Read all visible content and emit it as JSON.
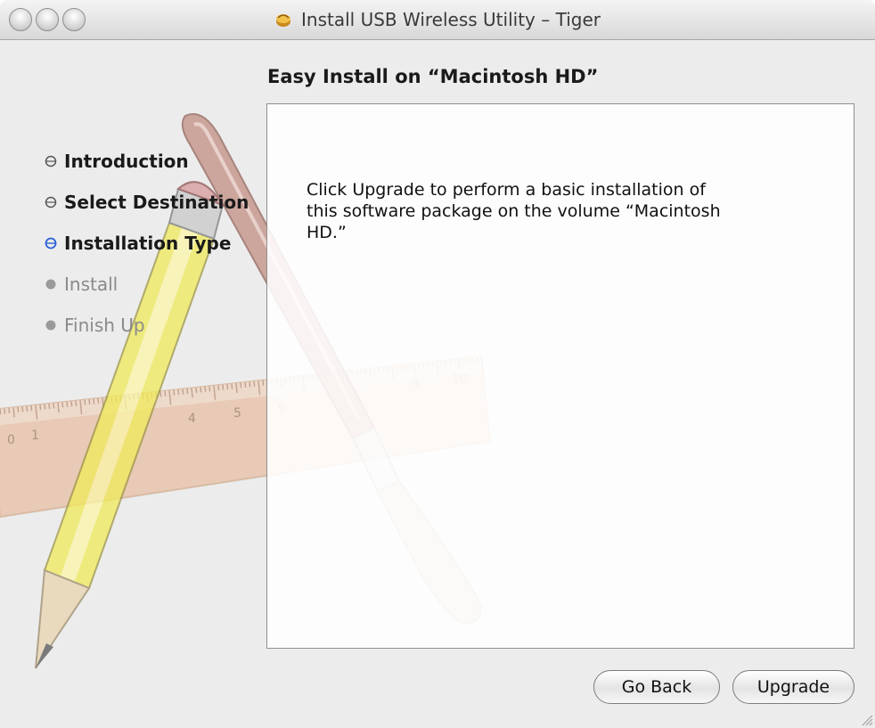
{
  "window": {
    "title": "Install USB Wireless Utility – Tiger"
  },
  "heading": "Easy Install on “Macintosh HD”",
  "steps": [
    {
      "label": "Introduction",
      "state": "done"
    },
    {
      "label": "Select Destination",
      "state": "done"
    },
    {
      "label": "Installation Type",
      "state": "current"
    },
    {
      "label": "Install",
      "state": "future"
    },
    {
      "label": "Finish Up",
      "state": "future"
    }
  ],
  "content": {
    "line1": "Click Upgrade to perform a basic installation of",
    "line2": "this software package on the volume “Macintosh",
    "line3": "HD.”"
  },
  "buttons": {
    "back": "Go Back",
    "upgrade": "Upgrade"
  },
  "ruler_numbers": [
    "0",
    "1",
    "4",
    "5",
    "6",
    "9",
    "10"
  ],
  "icons": {
    "title": "installer-package-icon",
    "step_done": "gray-circle-bullet",
    "step_current": "blue-circle-bullet",
    "step_future": "gray-dot-bullet"
  },
  "colors": {
    "step_current": "#2a62d8",
    "step_done": "#555555",
    "step_future": "#9a9a9a"
  }
}
